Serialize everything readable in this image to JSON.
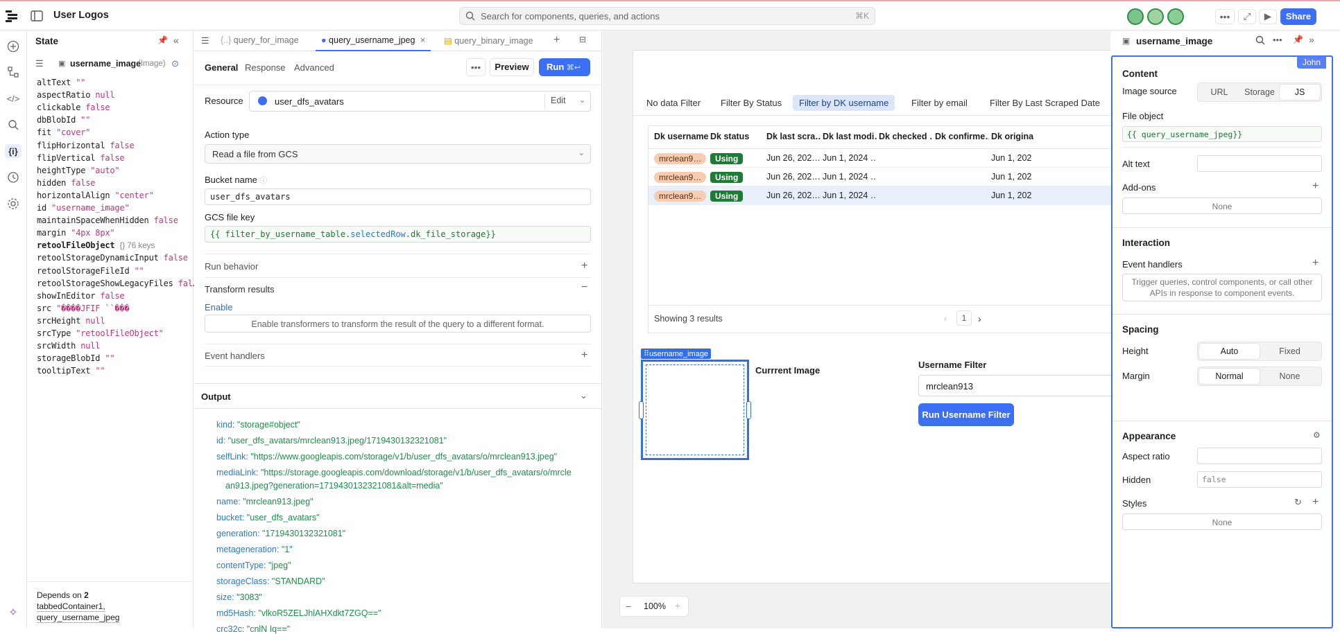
{
  "app": {
    "title": "User Logos",
    "search_placeholder": "Search for components, queries, and actions",
    "search_shortcut": "⌘K",
    "share_label": "Share"
  },
  "state": {
    "title": "State",
    "component": "username_image",
    "component_type": "(Image)",
    "props": [
      {
        "k": "altText",
        "v": "\"\""
      },
      {
        "k": "aspectRatio",
        "v": "null"
      },
      {
        "k": "clickable",
        "v": "false"
      },
      {
        "k": "dbBlobId",
        "v": "\"\""
      },
      {
        "k": "fit",
        "v": "\"cover\""
      },
      {
        "k": "flipHorizontal",
        "v": "false"
      },
      {
        "k": "flipVertical",
        "v": "false"
      },
      {
        "k": "heightType",
        "v": "\"auto\""
      },
      {
        "k": "hidden",
        "v": "false"
      },
      {
        "k": "horizontalAlign",
        "v": "\"center\""
      },
      {
        "k": "id",
        "v": "\"username_image\""
      },
      {
        "k": "maintainSpaceWhenHidden",
        "v": "false"
      },
      {
        "k": "margin",
        "v": "\"4px 8px\""
      },
      {
        "k": "retoolFileObject",
        "v": "{} 76 keys"
      },
      {
        "k": "retoolStorageDynamicInput",
        "v": "false"
      },
      {
        "k": "retoolStorageFileId",
        "v": "\"\""
      },
      {
        "k": "retoolStorageShowLegacyFiles",
        "v": "fal…"
      },
      {
        "k": "showInEditor",
        "v": "false"
      },
      {
        "k": "src",
        "v": "\"����JFIF ``���"
      },
      {
        "k": "srcHeight",
        "v": "null"
      },
      {
        "k": "srcType",
        "v": "\"retoolFileObject\""
      },
      {
        "k": "srcWidth",
        "v": "null"
      },
      {
        "k": "storageBlobId",
        "v": "\"\""
      },
      {
        "k": "tooltipText",
        "v": "\"\""
      }
    ],
    "depends_label": "Depends on",
    "depends_count": "2",
    "depends_1": "tabbedContainer1,",
    "depends_2": "query_username_jpeg"
  },
  "query": {
    "tabs": [
      "query_for_image",
      "query_username_jpeg",
      "query_binary_image"
    ],
    "subtabs": [
      "General",
      "Response",
      "Advanced"
    ],
    "preview_label": "Preview",
    "run_label": "Run",
    "run_shortcut": "⌘↩",
    "resource_label": "Resource",
    "resource_value": "user_dfs_avatars",
    "edit_label": "Edit",
    "action_type_label": "Action type",
    "action_type_value": "Read a file from GCS",
    "bucket_label": "Bucket name",
    "bucket_value": "user_dfs_avatars",
    "gcs_label": "GCS file key",
    "gcs_value_pre": "{{ filter_by_username_table.",
    "gcs_value_mid": "selectedRow",
    "gcs_value_post": ".dk_file_storage}}",
    "run_behavior_label": "Run behavior",
    "transform_label": "Transform results",
    "enable_label": "Enable",
    "transform_hint": "Enable transformers to transform the result of the query to a different format.",
    "event_handlers_label": "Event handlers",
    "output_label": "Output"
  },
  "output": [
    {
      "k": "kind:",
      "v": "\"storage#object\""
    },
    {
      "k": "id:",
      "v": "\"user_dfs_avatars/mrclean913.jpeg/1719430132321081\""
    },
    {
      "k": "selfLink:",
      "v": "\"https://www.googleapis.com/storage/v1/b/user_dfs_avatars/o/mrclean913.jpeg\""
    },
    {
      "k": "mediaLink:",
      "v": "\"https://storage.googleapis.com/download/storage/v1/b/user_dfs_avatars/o/mrcle"
    },
    {
      "k": "",
      "v": "an913.jpeg?generation=1719430132321081&alt=media\""
    },
    {
      "k": "name:",
      "v": "\"mrclean913.jpeg\""
    },
    {
      "k": "bucket:",
      "v": "\"user_dfs_avatars\""
    },
    {
      "k": "generation:",
      "v": "\"1719430132321081\""
    },
    {
      "k": "metageneration:",
      "v": "\"1\""
    },
    {
      "k": "contentType:",
      "v": "\"jpeg\""
    },
    {
      "k": "storageClass:",
      "v": "\"STANDARD\""
    },
    {
      "k": "size:",
      "v": "\"3083\""
    },
    {
      "k": "md5Hash:",
      "v": "\"vlkoR5ZELJhlAHXdkt7ZGQ==\""
    },
    {
      "k": "crc32c:",
      "v": "\"cnlN Iq==\""
    }
  ],
  "canvas": {
    "filters": [
      "No data Filter",
      "Filter By Status",
      "Filter by DK username",
      "Filter by email",
      "Filter By Last Scraped Date"
    ],
    "columns": [
      "Dk username",
      "Dk status",
      "Dk last scra…",
      "Dk last modi…",
      "Dk checked …",
      "Dk confirme…",
      "Dk origina"
    ],
    "rows": [
      [
        "mrclean9…",
        "Using",
        "Jun 26, 202…",
        "Jun 1, 2024 …",
        "",
        "",
        "Jun 1, 202"
      ],
      [
        "mrclean9…",
        "Using",
        "Jun 26, 202…",
        "Jun 1, 2024 …",
        "",
        "",
        "Jun 1, 202"
      ],
      [
        "mrclean9…",
        "Using",
        "Jun 26, 202…",
        "Jun 1, 2024 …",
        "",
        "",
        "Jun 1, 202"
      ]
    ],
    "showing": "Showing 3 results",
    "page": "1",
    "image_tag": "username_image",
    "current_image_label": "Currrent Image",
    "username_filter_label": "Username Filter",
    "username_filter_value": "mrclean913",
    "run_filter_label": "Run Username Filter",
    "zoom": "100%"
  },
  "inspector": {
    "title": "username_image",
    "user_badge": "John",
    "content_label": "Content",
    "image_source_label": "Image source",
    "image_source_options": [
      "URL",
      "Storage",
      "JS"
    ],
    "file_object_label": "File object",
    "file_object_value": "{{ query_username_jpeg}}",
    "alt_text_label": "Alt text",
    "addons_label": "Add-ons",
    "none": "None",
    "interaction_label": "Interaction",
    "event_handlers_label": "Event handlers",
    "event_hint": "Trigger queries, control components, or call other APIs in response to component events.",
    "spacing_label": "Spacing",
    "height_label": "Height",
    "height_options": [
      "Auto",
      "Fixed"
    ],
    "margin_label": "Margin",
    "margin_options": [
      "Normal",
      "None"
    ],
    "appearance_label": "Appearance",
    "aspect_label": "Aspect ratio",
    "hidden_label": "Hidden",
    "hidden_value": "false",
    "styles_label": "Styles"
  },
  "colors": {
    "accent": "#3d6ff6",
    "green_tag": "#1f7a35",
    "orange_tag": "#f6cdb0"
  }
}
